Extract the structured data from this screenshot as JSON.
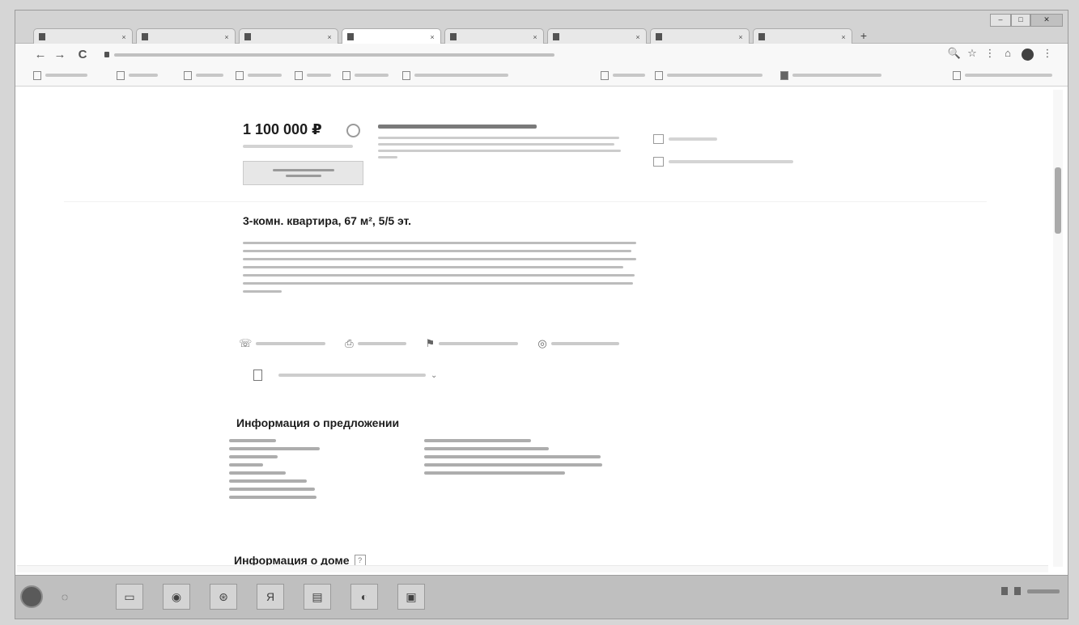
{
  "browser": {
    "tab_count": 8,
    "active_tab_index": 3,
    "new_tab_label": "+"
  },
  "nav": {
    "back_glyph": "←",
    "forward_glyph": "→",
    "reload_glyph": "C"
  },
  "toolbar_glyphs": {
    "zoom": "🔍",
    "star": "☆",
    "translate": "⋮",
    "home": "⌂",
    "menu": "⋮"
  },
  "listing": {
    "price": "1 100 000 ₽",
    "title": "3-комн. квартира, 67 м², 5/5 эт."
  },
  "sections": {
    "offer_heading": "Информация о предложении",
    "house_heading": "Информация о доме"
  },
  "taskbar": {
    "items": [
      "folder",
      "chrome",
      "yandex",
      "document",
      "browser",
      "pdf"
    ]
  }
}
